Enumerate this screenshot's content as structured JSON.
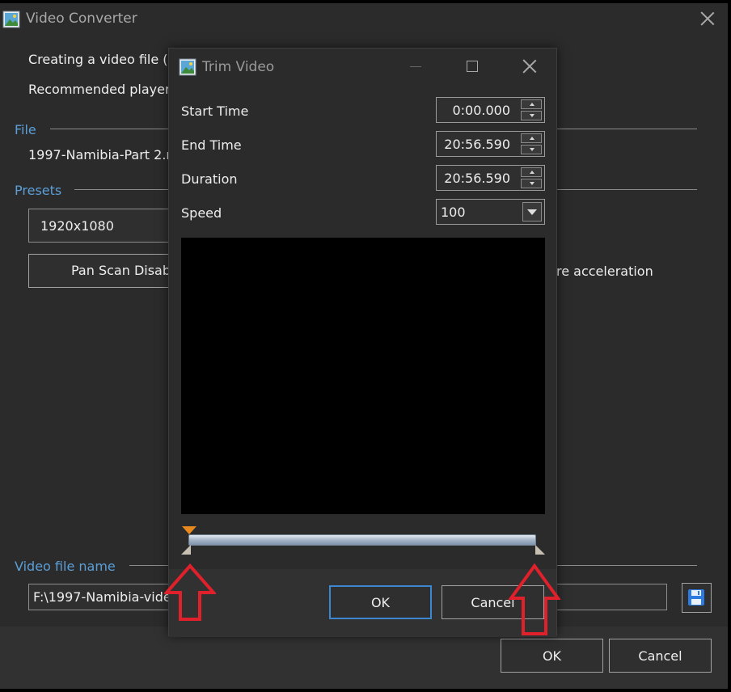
{
  "window": {
    "title": "Video Converter"
  },
  "main": {
    "info_line_1": "Creating a video file (in",
    "info_line_2": "Recommended player",
    "file_section": "File",
    "file_name": "1997-Namibia-Part 2.m",
    "presets_section": "Presets",
    "preset_value": "1920x1080",
    "pan_scan_button": "Pan  Scan Disab",
    "hw_accel_text": "re acceleration",
    "video_file_section": "Video file name",
    "video_file_path": "F:\\1997-Namibia-vide",
    "ok_label": "OK",
    "cancel_label": "Cancel"
  },
  "dialog": {
    "title": "Trim Video",
    "fields": [
      {
        "label": "Start Time",
        "value": "0:00.000"
      },
      {
        "label": "End Time",
        "value": "20:56.590"
      },
      {
        "label": "Duration",
        "value": "20:56.590"
      }
    ],
    "speed_label": "Speed",
    "speed_value": "100",
    "ok_label": "OK",
    "cancel_label": "Cancel"
  },
  "icons": {
    "app": "picture-icon",
    "close": "close-icon",
    "minimize": "minimize-icon",
    "maximize": "maximize-icon",
    "save": "floppy-disk-icon",
    "annotation": "red-arrow-icon"
  },
  "colors": {
    "accent_blue": "#5b9fd8",
    "ok_focus_border": "#3c87d0",
    "annotation_red": "#e0202a",
    "playhead": "#e7891e"
  }
}
